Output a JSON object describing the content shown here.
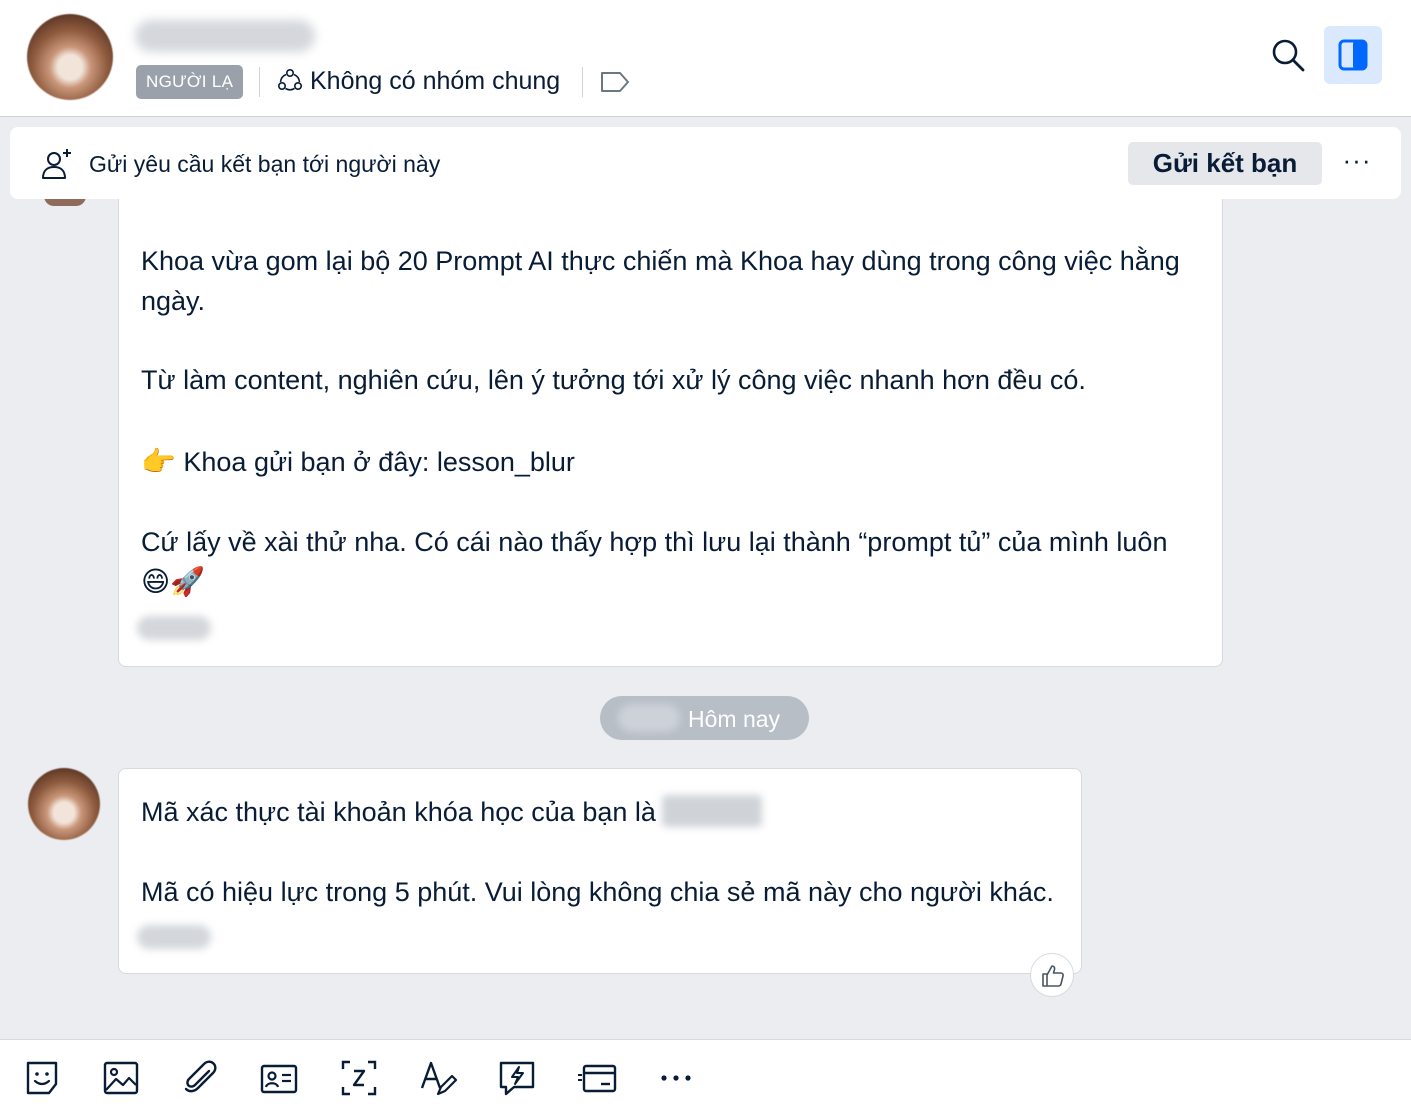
{
  "header": {
    "badge": "NGƯỜI LẠ",
    "groups_text": "Không có nhóm chung"
  },
  "friend_bar": {
    "prompt": "Gửi yêu cầu kết bạn tới người này",
    "button": "Gửi kết bạn",
    "more": "···"
  },
  "messages": [
    {
      "lines": [
        "Khoa vừa gom lại bộ 20 Prompt AI thực chiến mà Khoa hay dùng trong công việc hằng ngày.",
        "Từ làm content, nghiên cứu, lên ý tưởng tới xử lý công việc nhanh hơn đều có.",
        "Khoa gửi bạn ở đây: lesson_blur",
        "Cứ lấy về xài thử nha. Có cái nào thấy hợp thì lưu lại thành “prompt tủ” của mình luôn"
      ],
      "pointer_emoji": "👉",
      "end_emojis": "😄🚀"
    },
    {
      "lines": [
        "Mã xác thực tài khoản khóa học của bạn là",
        "Mã có hiệu lực trong 5 phút. Vui lòng không chia sẻ mã này cho người khác."
      ]
    }
  ],
  "date_separator": "Hôm nay",
  "icons": {
    "header": [
      "avatar",
      "group-icon",
      "tag-icon",
      "search-icon",
      "sidebar-toggle-icon"
    ],
    "friend_bar": [
      "add-user-icon"
    ],
    "reaction": "thumbs-up-icon",
    "toolbar": [
      "sticker-icon",
      "image-icon",
      "attachment-icon",
      "contact-card-icon",
      "screenshot-icon",
      "text-format-icon",
      "quick-message-icon",
      "card-icon",
      "more-icon"
    ]
  },
  "colors": {
    "accent": "#0068ff",
    "toggle_bg": "#dbe9ff",
    "badge_bg": "#9aa1ab",
    "chat_bg": "#ebedf0",
    "text": "#081c36"
  }
}
